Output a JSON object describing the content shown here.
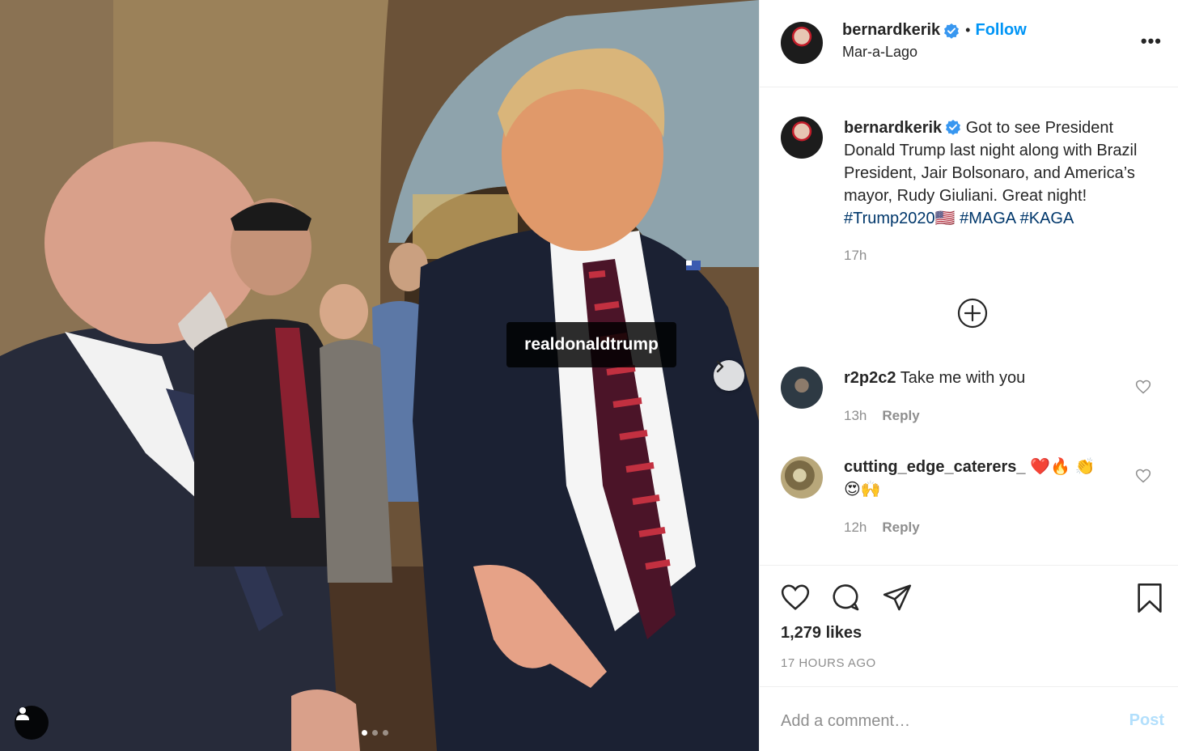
{
  "photo": {
    "tag_label": "realdonaldtrump",
    "carousel_count": 3,
    "carousel_active_index": 0
  },
  "header": {
    "username": "bernardkerik",
    "verified": true,
    "separator": "•",
    "follow_label": "Follow",
    "location": "Mar-a-Lago",
    "more_label": "•••"
  },
  "caption": {
    "username": "bernardkerik",
    "text": "Got to see President Donald Trump last night along with Brazil President, Jair Bolsonaro, and America’s mayor, Rudy Giuliani. Great night!",
    "hashtags": [
      "#Trump2020🇺🇸",
      "#MAGA",
      "#KAGA"
    ],
    "time": "17h"
  },
  "comments": [
    {
      "username": "r2p2c2",
      "text": "Take me with you",
      "time": "13h",
      "reply_label": "Reply"
    },
    {
      "username": "cutting_edge_caterers_",
      "text": "❤️🔥 👏😍🙌",
      "time": "12h",
      "reply_label": "Reply"
    }
  ],
  "stats": {
    "likes": "1,279 likes",
    "time_ago": "17 HOURS AGO"
  },
  "add_comment": {
    "placeholder": "Add a comment…",
    "post_label": "Post"
  },
  "colors": {
    "link_blue": "#0095f6",
    "hashtag_blue": "#00376b",
    "muted_gray": "#8e8e8e",
    "post_disabled": "#b2dffc",
    "text": "#262626"
  }
}
